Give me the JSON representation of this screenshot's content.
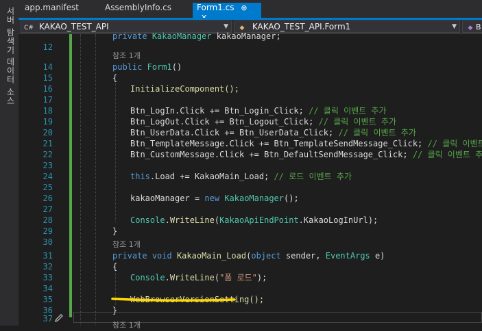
{
  "side_tabs": [
    "서버 탐색기",
    "데이터 소스"
  ],
  "tabs": [
    {
      "label": "app.manifest"
    },
    {
      "label": "AssemblyInfo.cs"
    },
    {
      "label": "Form1.cs",
      "pin": "⊕",
      "close": "✕"
    }
  ],
  "nav": {
    "project_icon": "C#",
    "project": "KAKAO_TEST_API",
    "class_icon": "◆",
    "class": "KAKAO_TEST_API.Form1",
    "member_icon": "◆",
    "member": "B"
  },
  "ref_label": "참조 1개",
  "lines": {
    "l12": {
      "n": "12",
      "kw1": "private",
      "ty": "KakaoManager",
      "rest": "kakaoManager;"
    },
    "l14": {
      "n": "14",
      "kw1": "public",
      "name": "Form1",
      "rest": "()"
    },
    "l15": {
      "n": "15",
      "t": "{"
    },
    "l16": {
      "n": "16",
      "t": "InitializeComponent();"
    },
    "l17": {
      "n": "17"
    },
    "l18": {
      "n": "18",
      "obj": "Btn_LogIn.Click +=",
      "fn": "Btn_Login_Click;",
      "cm": "// 클릭 이벤트 추가"
    },
    "l19": {
      "n": "19",
      "obj": "Btn_LogOut.Click +=",
      "fn": "Btn_Logout_Click;",
      "cm": "// 클릭 이벤트 추가"
    },
    "l20": {
      "n": "20",
      "obj": "Btn_UserData.Click +=",
      "fn": "Btn_UserData_Click;",
      "cm": "// 클릭 이벤트 추가"
    },
    "l21": {
      "n": "21",
      "obj": "Btn_TemplateMessage.Click +=",
      "fn": "Btn_TemplateSendMessage_Click;",
      "cm": "// 클릭 이벤트 추가"
    },
    "l22": {
      "n": "22",
      "obj": "Btn_CustomMessage.Click +=",
      "fn": "Btn_DefaultSendMessage_Click;",
      "cm": "// 클릭 이벤트 추가"
    },
    "l23": {
      "n": "23"
    },
    "l24": {
      "n": "24",
      "kw": "this",
      "mid": ".Load +=",
      "fn": "KakaoMain_Load;",
      "cm": "// 로드 이벤트 추가"
    },
    "l25": {
      "n": "25"
    },
    "l26": {
      "n": "26",
      "a": "kakaoManager =",
      "kw": "new",
      "ty": "KakaoManager",
      "b": "();"
    },
    "l27": {
      "n": "27"
    },
    "l28": {
      "n": "28",
      "ty": "Console",
      "me": "WriteLine",
      "a": "(",
      "ty2": "KakaoApiEndPoint",
      "b": ".KakaoLogInUrl);"
    },
    "l29": {
      "n": "29",
      "t": "}"
    },
    "l30": {
      "n": "30"
    },
    "l31": {
      "n": "31",
      "kw1": "private",
      "kw2": "void",
      "name": "KakaoMain_Load",
      "a": "(",
      "kw3": "object",
      "b": "sender,",
      "ty": "EventArgs",
      "c": "e)"
    },
    "l32": {
      "n": "32",
      "t": "{"
    },
    "l33": {
      "n": "33",
      "ty": "Console",
      "me": "WriteLine",
      "a": "(",
      "st": "\"폼 로드\"",
      "b": ");"
    },
    "l34": {
      "n": "34"
    },
    "l35": {
      "n": "35",
      "t": "WebBrowserVersionSetting();"
    },
    "l36": {
      "n": "36",
      "t": "}"
    },
    "l37": {
      "n": "37"
    },
    "l38": {
      "ref": "참조 1개"
    }
  },
  "colors": {
    "accent": "#007acc",
    "highlight": "#ffd700",
    "change_bar": "#57a64a"
  }
}
